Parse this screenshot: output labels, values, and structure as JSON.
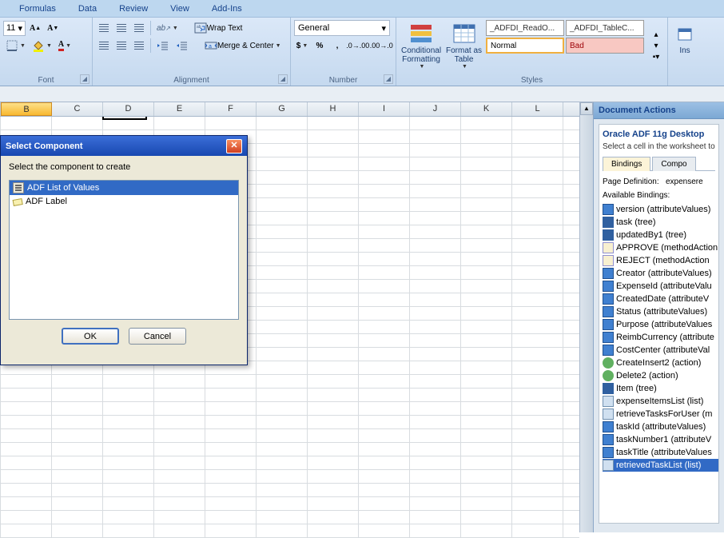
{
  "ribbon_tabs": [
    "Formulas",
    "Data",
    "Review",
    "View",
    "Add-Ins"
  ],
  "ribbon": {
    "font": {
      "size": "11",
      "group": "Font"
    },
    "alignment": {
      "wrap": "Wrap Text",
      "merge": "Merge & Center",
      "group": "Alignment"
    },
    "number": {
      "format": "General",
      "group": "Number"
    },
    "styles": {
      "cond": "Conditional Formatting",
      "table": "Format as Table",
      "cells": {
        "readonly": "_ADFDI_ReadO...",
        "tablec": "_ADFDI_TableC...",
        "normal": "Normal",
        "bad": "Bad"
      },
      "group": "Styles"
    },
    "insert": "Ins"
  },
  "columns": [
    "B",
    "C",
    "D",
    "E",
    "F",
    "G",
    "H",
    "I",
    "J",
    "K",
    "L"
  ],
  "selected_column": "B",
  "dialog": {
    "title": "Select Component",
    "instruction": "Select the component to create",
    "items": [
      "ADF List of Values",
      "ADF Label"
    ],
    "selected": 0,
    "ok": "OK",
    "cancel": "Cancel"
  },
  "doc_actions": {
    "title": "Document Actions",
    "heading": "Oracle ADF 11g Desktop",
    "sub": "Select a cell in the worksheet to",
    "tabs": [
      "Bindings",
      "Compo"
    ],
    "active_tab": 0,
    "page_def_label": "Page Definition:",
    "page_def_value": "expensere",
    "avail_label": "Available Bindings:",
    "bindings": [
      {
        "t": "attr",
        "label": "version (attributeValues)"
      },
      {
        "t": "tree",
        "label": "task (tree)"
      },
      {
        "t": "tree",
        "label": "updatedBy1 (tree)"
      },
      {
        "t": "method",
        "label": "APPROVE (methodAction"
      },
      {
        "t": "method",
        "label": "REJECT (methodAction"
      },
      {
        "t": "attr",
        "label": "Creator (attributeValues)"
      },
      {
        "t": "attr",
        "label": "ExpenseId (attributeValu"
      },
      {
        "t": "attr",
        "label": "CreatedDate (attributeV"
      },
      {
        "t": "attr",
        "label": "Status (attributeValues)"
      },
      {
        "t": "attr",
        "label": "Purpose (attributeValues"
      },
      {
        "t": "attr",
        "label": "ReimbCurrency (attribute"
      },
      {
        "t": "attr",
        "label": "CostCenter (attributeVal"
      },
      {
        "t": "action",
        "label": "CreateInsert2 (action)"
      },
      {
        "t": "action",
        "label": "Delete2 (action)"
      },
      {
        "t": "tree",
        "label": "Item (tree)"
      },
      {
        "t": "list",
        "label": "expenseItemsList (list)"
      },
      {
        "t": "list",
        "label": "retrieveTasksForUser (m"
      },
      {
        "t": "attr",
        "label": "taskId (attributeValues)"
      },
      {
        "t": "attr",
        "label": "taskNumber1 (attributeV"
      },
      {
        "t": "attr",
        "label": "taskTitle (attributeValues"
      },
      {
        "t": "list",
        "label": "retrievedTaskList (list)",
        "selected": true
      }
    ]
  }
}
